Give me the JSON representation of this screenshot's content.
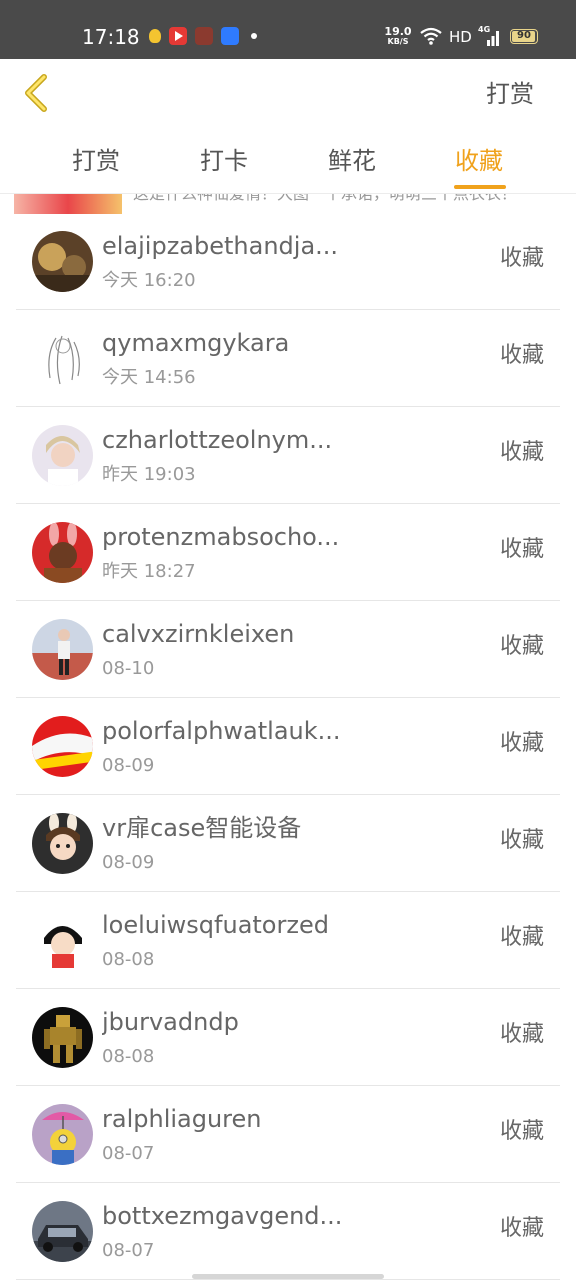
{
  "status_bar": {
    "time": "17:18",
    "net_speed": "19.0",
    "net_speed_unit": "KB/S",
    "hd": "HD",
    "network_type": "4G",
    "battery": "90",
    "icons": [
      "bulb-icon",
      "video-app-icon",
      "avatar-app-icon",
      "cloud-app-icon"
    ]
  },
  "header": {
    "back_icon": "chevron-left-icon",
    "action_label": "打赏"
  },
  "tabs": [
    {
      "label": "打赏",
      "active": false
    },
    {
      "label": "打卡",
      "active": false
    },
    {
      "label": "鲜花",
      "active": false
    },
    {
      "label": "收藏",
      "active": true
    }
  ],
  "partial_row": {
    "thumb_text": "",
    "text": "这是什么神仙爱情？大图一个承诺，萌萌三个点衣衣？"
  },
  "rows": [
    {
      "name": "elajipzabethandja...",
      "time": "今天 16:20",
      "badge": "收藏"
    },
    {
      "name": "qymaxmgykara",
      "time": "今天 14:56",
      "badge": "收藏"
    },
    {
      "name": "czharlottzeolnym...",
      "time": "昨天 19:03",
      "badge": "收藏"
    },
    {
      "name": "protenzmabsocho...",
      "time": "昨天 18:27",
      "badge": "收藏"
    },
    {
      "name": "calvxzirnkleixen",
      "time": "08-10",
      "badge": "收藏"
    },
    {
      "name": "polorfalphwatlauk...",
      "time": "08-09",
      "badge": "收藏"
    },
    {
      "name": "vr扉case智能设备",
      "time": "08-09",
      "badge": "收藏"
    },
    {
      "name": "loeluiwsqfuatorzed",
      "time": "08-08",
      "badge": "收藏"
    },
    {
      "name": "jburvadndp",
      "time": "08-08",
      "badge": "收藏"
    },
    {
      "name": "ralphliaguren",
      "time": "08-07",
      "badge": "收藏"
    },
    {
      "name": "bottxezmgavgend...",
      "time": "08-07",
      "badge": "收藏"
    }
  ],
  "colors": {
    "accent": "#f0a21c",
    "status_bar": "#4a4a4a",
    "text_primary": "#666666",
    "text_secondary": "#999999"
  }
}
